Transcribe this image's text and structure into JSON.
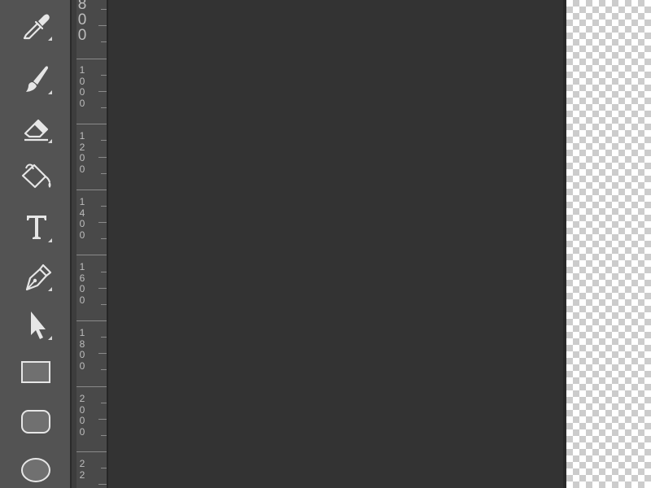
{
  "tools": [
    {
      "name": "eyedropper-tool",
      "icon": "eyedropper-icon",
      "has_flyout": true
    },
    {
      "name": "brush-tool",
      "icon": "brush-icon",
      "has_flyout": true
    },
    {
      "name": "eraser-tool",
      "icon": "eraser-icon",
      "has_flyout": true
    },
    {
      "name": "paint-bucket-tool",
      "icon": "paint-bucket-icon",
      "has_flyout": false
    },
    {
      "name": "type-tool",
      "icon": "type-icon",
      "has_flyout": true
    },
    {
      "name": "pen-tool",
      "icon": "pen-icon",
      "has_flyout": true
    },
    {
      "name": "path-selection-tool",
      "icon": "arrow-cursor-icon",
      "has_flyout": true
    },
    {
      "name": "rectangle-tool",
      "icon": "rectangle-icon",
      "has_flyout": false
    },
    {
      "name": "rounded-rectangle-tool",
      "icon": "rounded-rectangle-icon",
      "has_flyout": false
    },
    {
      "name": "ellipse-tool",
      "icon": "ellipse-icon",
      "has_flyout": false
    }
  ],
  "ruler": {
    "labels": [
      "800",
      "1000",
      "1200",
      "1400",
      "1600",
      "1800",
      "2000",
      "22"
    ]
  },
  "colors": {
    "panel": "#535353",
    "ruler": "#494949",
    "canvas": "#333333",
    "checker_light": "#ffffff",
    "checker_dark": "#cccccc"
  }
}
